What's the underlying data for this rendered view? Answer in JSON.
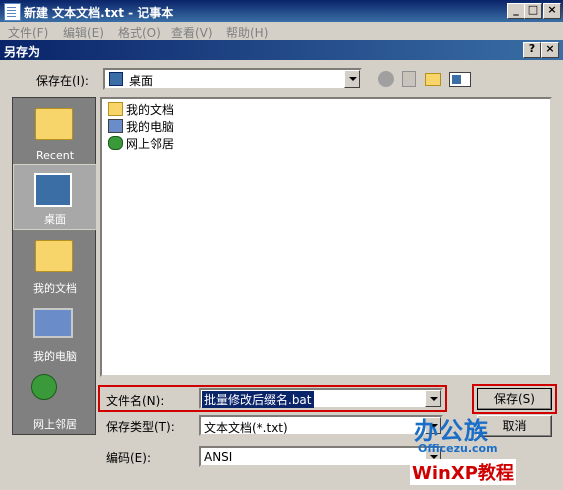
{
  "notepad": {
    "title": "新建 文本文档.txt - 记事本",
    "menu": [
      "文件(F)",
      "编辑(E)",
      "格式(O)",
      "查看(V)",
      "帮助(H)"
    ],
    "min": "_",
    "max": "□",
    "close": "×"
  },
  "dialog": {
    "title": "另存为",
    "help": "?",
    "close": "×",
    "save_in_label": "保存在(I):",
    "save_in_value": "桌面",
    "places": [
      "Recent",
      "桌面",
      "我的文档",
      "我的电脑",
      "网上邻居"
    ],
    "selected_place": "桌面",
    "files": [
      "我的文档",
      "我的电脑",
      "网上邻居"
    ],
    "filename_label": "文件名(N):",
    "filename_value": "批量修改后缀名.bat",
    "filetype_label": "保存类型(T):",
    "filetype_value": "文本文档(*.txt)",
    "encoding_label": "编码(E):",
    "encoding_value": "ANSI",
    "save_button": "保存(S)",
    "cancel_button": "取消"
  },
  "watermark": {
    "line1": "办公族",
    "line2": "Officezu.com",
    "line3": "WinXP教程"
  },
  "colors": {
    "highlight": "#d00000",
    "titlebar": "#0a246a",
    "face": "#d4d0c8"
  },
  "icons": [
    "notepad-icon",
    "desktop-icon",
    "back-icon",
    "up-folder-icon",
    "new-folder-icon",
    "view-menu-icon",
    "folder-icon",
    "computer-icon",
    "network-icon",
    "recent-icon"
  ]
}
